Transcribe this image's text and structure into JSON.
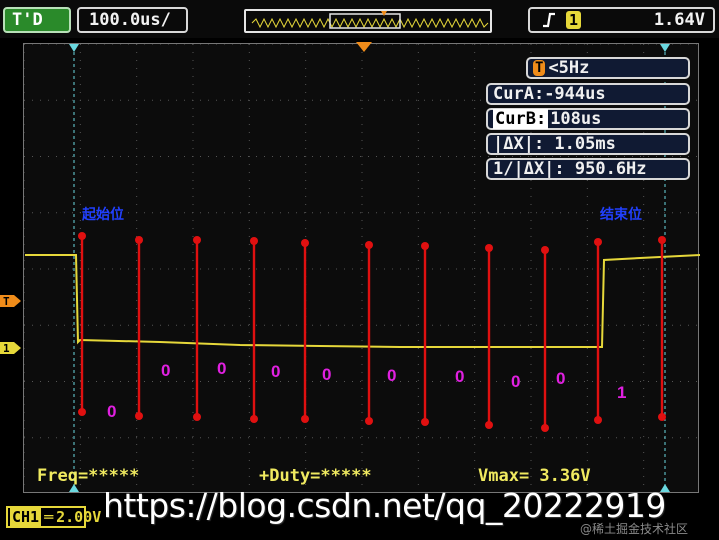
{
  "header": {
    "mode": "T'D",
    "timebase": "100.0us/",
    "trigger": {
      "slope_icon": "rising-edge-icon",
      "channel": "1",
      "level": "1.64V"
    }
  },
  "measurements": {
    "trigger_freq": "<5Hz",
    "cur_a_label": "CurA:",
    "cur_a_value": "-944us",
    "cur_b_label": "CurB:",
    "cur_b_value": "108us",
    "delta_x": "|ΔX|: 1.05ms",
    "inv_delta_x": "1/|ΔX|: 950.6Hz"
  },
  "annotations": {
    "start_label": "起始位",
    "stop_label": "结束位",
    "bits": [
      "0",
      "0",
      "0",
      "0",
      "0",
      "0",
      "0",
      "0",
      "0",
      "1"
    ],
    "marker_color": "#e01010",
    "label_color": "#2140ff",
    "bit_color": "#e020e0"
  },
  "bottom": {
    "freq": "Freq=*****",
    "duty": "+Duty=*****",
    "vmax": "Vmax= 3.36V"
  },
  "channel_box": {
    "name": "CH1",
    "scale": "2.00V"
  },
  "watermark": "https://blog.csdn.net/qq_20222919",
  "credit": "@稀土掘金技术社区",
  "colors": {
    "trace": "#e6d83a",
    "cursor": "#6ad8e0",
    "trigger_marker": "#f08c1a",
    "grid": "#555555"
  }
}
